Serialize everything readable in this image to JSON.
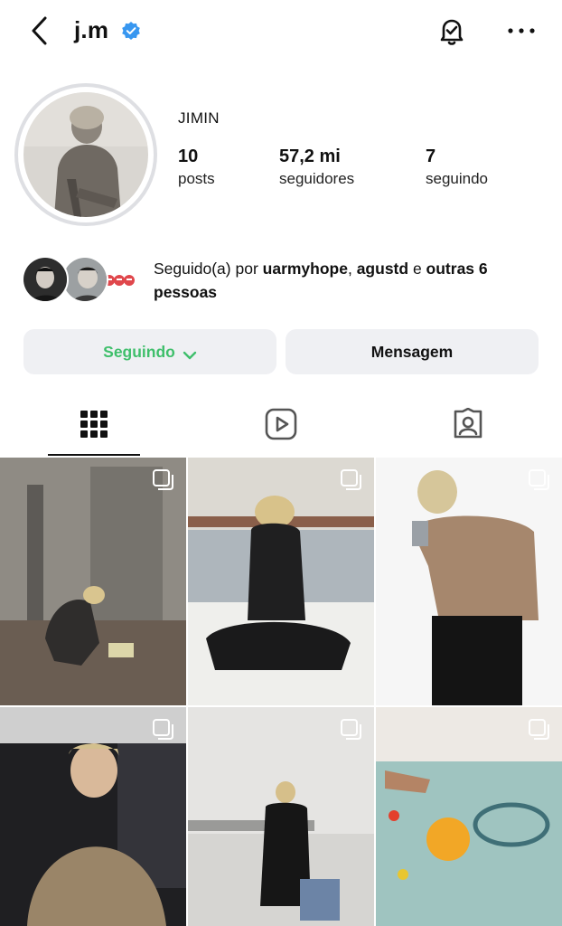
{
  "header": {
    "username": "j.m",
    "verified": true,
    "icons": [
      "back-arrow-icon",
      "verified-badge-icon",
      "notification-bell-icon",
      "more-options-icon"
    ]
  },
  "profile": {
    "display_name": "JIMIN",
    "stats": [
      {
        "value": "10",
        "label": "posts"
      },
      {
        "value": "57,2 mi",
        "label": "seguidores"
      },
      {
        "value": "7",
        "label": "seguindo"
      }
    ]
  },
  "followed_by": {
    "prefix": "Seguido(a) por ",
    "user1": "uarmyhope",
    "separator": ", ",
    "user2": "agustd",
    "connector": " e ",
    "others": "outras 6 pessoas"
  },
  "actions": {
    "following_label": "Seguindo",
    "message_label": "Mensagem"
  },
  "tabs": [
    "grid-icon",
    "reels-icon",
    "tagged-icon"
  ],
  "colors": {
    "accent_green": "#3fbf6b",
    "button_bg": "#eff0f3",
    "verified_blue": "#3897f0",
    "avatar_ring": "#dedfe3"
  },
  "posts": [
    {
      "id": "post-1",
      "multi": true
    },
    {
      "id": "post-2",
      "multi": true
    },
    {
      "id": "post-3",
      "multi": true
    },
    {
      "id": "post-4",
      "multi": true
    },
    {
      "id": "post-5",
      "multi": true
    },
    {
      "id": "post-6",
      "multi": true
    }
  ]
}
